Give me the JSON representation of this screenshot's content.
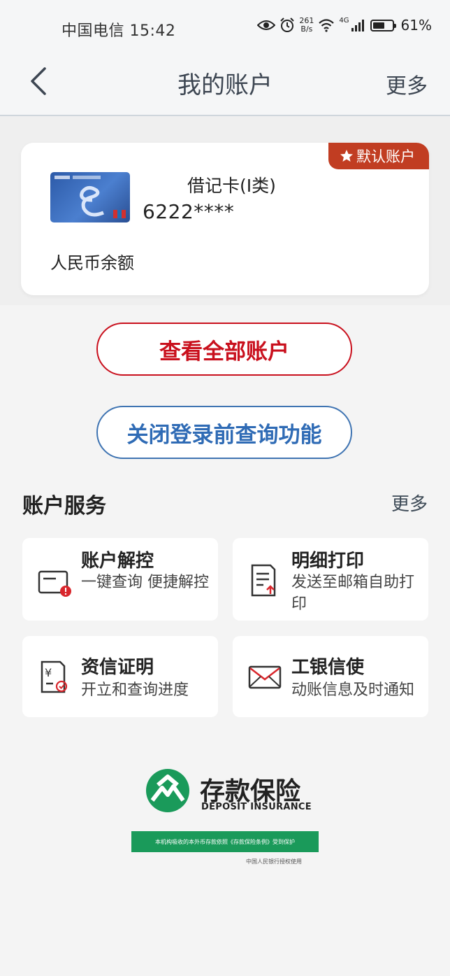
{
  "status_bar": {
    "carrier_time": "中国电信 15:42",
    "net_speed_value": "261",
    "net_speed_unit": "B/s",
    "network": "4G",
    "battery": "61%",
    "battery_level": 0.61
  },
  "header": {
    "title": "我的账户",
    "more": "更多"
  },
  "account_card": {
    "default_tag": "默认账户",
    "card_type": "借记卡(I类)",
    "card_number": "6222****",
    "balance_label": "人民币余额"
  },
  "buttons": {
    "view_all": "查看全部账户",
    "close_query": "关闭登录前查询功能"
  },
  "services": {
    "title": "账户服务",
    "more": "更多",
    "items": [
      {
        "title": "账户解控",
        "desc": "一键查询 便捷解控"
      },
      {
        "title": "明细打印",
        "desc": "发送至邮箱自助打印"
      },
      {
        "title": "资信证明",
        "desc": "开立和查询进度"
      },
      {
        "title": "工银信使",
        "desc": "动账信息及时通知"
      }
    ]
  },
  "deposit_insurance": {
    "cn": "存款保险",
    "en": "DEPOSIT INSURANCE",
    "banner": "本机构吸收的本外币存款依照《存款保险条例》受到保护",
    "note": "中国人民银行授权使用"
  },
  "colors": {
    "red": "#c9101d",
    "blue": "#2f6bb5",
    "tag_red": "#c13d22",
    "green": "#1a9a5a"
  }
}
